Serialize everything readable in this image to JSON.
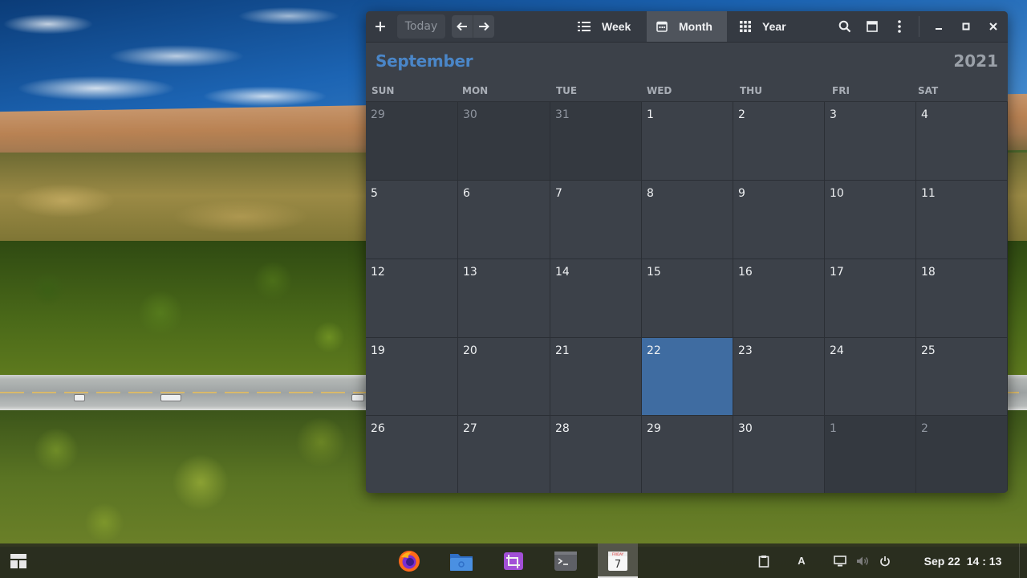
{
  "headerbar": {
    "today_label": "Today",
    "views": [
      {
        "label": "Week",
        "icon": "week-list-icon",
        "active": false
      },
      {
        "label": "Month",
        "icon": "calendar-month-icon",
        "active": true
      },
      {
        "label": "Year",
        "icon": "grid-year-icon",
        "active": false
      }
    ],
    "actions": [
      "add-icon",
      "arrow-left-icon",
      "arrow-right-icon",
      "search-icon",
      "calendars-icon",
      "more-vertical-icon",
      "minimize-icon",
      "maximize-icon",
      "close-icon"
    ]
  },
  "month_view": {
    "month": "September",
    "year": "2021",
    "weekdays": [
      "SUN",
      "MON",
      "TUE",
      "WED",
      "THU",
      "FRI",
      "SAT"
    ],
    "weeks": [
      [
        {
          "day": "29",
          "outside": true
        },
        {
          "day": "30",
          "outside": true
        },
        {
          "day": "31",
          "outside": true
        },
        {
          "day": "1"
        },
        {
          "day": "2"
        },
        {
          "day": "3"
        },
        {
          "day": "4"
        }
      ],
      [
        {
          "day": "5"
        },
        {
          "day": "6"
        },
        {
          "day": "7"
        },
        {
          "day": "8"
        },
        {
          "day": "9"
        },
        {
          "day": "10"
        },
        {
          "day": "11"
        }
      ],
      [
        {
          "day": "12"
        },
        {
          "day": "13"
        },
        {
          "day": "14"
        },
        {
          "day": "15"
        },
        {
          "day": "16"
        },
        {
          "day": "17"
        },
        {
          "day": "18"
        }
      ],
      [
        {
          "day": "19"
        },
        {
          "day": "20"
        },
        {
          "day": "21"
        },
        {
          "day": "22",
          "today": true
        },
        {
          "day": "23"
        },
        {
          "day": "24"
        },
        {
          "day": "25"
        }
      ],
      [
        {
          "day": "26"
        },
        {
          "day": "27"
        },
        {
          "day": "28"
        },
        {
          "day": "29"
        },
        {
          "day": "30"
        },
        {
          "day": "1",
          "outside": true
        },
        {
          "day": "2",
          "outside": true
        }
      ]
    ]
  },
  "taskbar": {
    "apps": [
      "app-menu-icon",
      "firefox-icon",
      "files-icon",
      "screenshot-crop-icon",
      "terminal-icon",
      "calendar-icon"
    ],
    "calendar_icon_day_label": "FRIDAY",
    "calendar_icon_day": "7",
    "keyboard_layout": "A",
    "tray": [
      "clipboard-icon",
      "display-icon",
      "volume-icon",
      "power-icon"
    ],
    "clock_date": "Sep 22",
    "clock_time": "14 : 13"
  },
  "colors": {
    "accent": "#4a86c8",
    "today_cell": "#3f6ca1",
    "window_bg": "#3c4149",
    "headerbar_bg": "#353a42"
  }
}
